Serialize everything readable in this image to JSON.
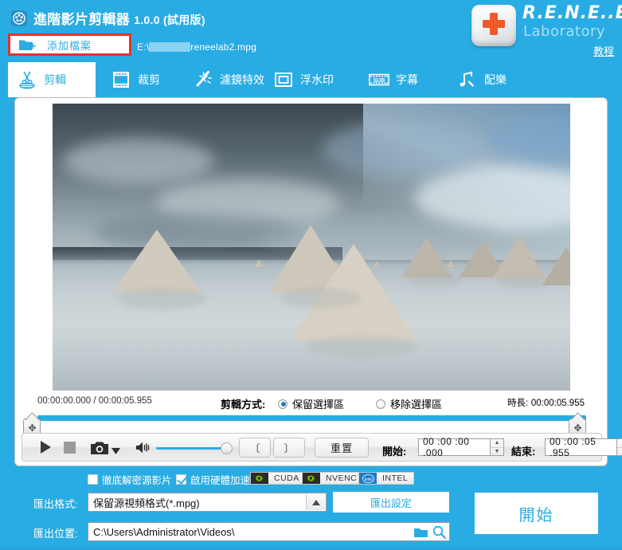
{
  "window": {
    "title": "進階影片剪輯器",
    "version": "1.0.0 (試用版)",
    "app_icon": "film-reel-icon"
  },
  "brand": {
    "name": "R.E.N.E..E",
    "subtitle": "Laboratory",
    "tutorial_link": "教程"
  },
  "toolbar": {
    "add_file_label": "添加檔案",
    "add_file_icon": "add-folder-icon",
    "file_path_prefix": "E:\\",
    "file_path_suffix": "\\reneelab2.mpg",
    "file_name": "reneelab2.mpg"
  },
  "tabs": [
    {
      "id": "edit",
      "label": "剪輯",
      "icon": "scissors-icon",
      "active": true
    },
    {
      "id": "crop",
      "label": "裁剪",
      "icon": "crop-film-icon",
      "active": false
    },
    {
      "id": "filter",
      "label": "濾鏡特效",
      "icon": "magic-wand-icon",
      "active": false
    },
    {
      "id": "watermark",
      "label": "浮水印",
      "icon": "watermark-icon",
      "active": false
    },
    {
      "id": "subtitle",
      "label": "字幕",
      "icon": "sub-film-icon",
      "active": false
    },
    {
      "id": "music",
      "label": "配樂",
      "icon": "music-note-icon",
      "active": false
    }
  ],
  "preview": {
    "description": "salt-flat-cones-video-frame"
  },
  "timeline": {
    "position_label": "00:00:00.000 / 00:00:05.955",
    "current_time": "00:00:00.000",
    "total_time": "00:00:05.955",
    "mode_label": "剪輯方式:",
    "mode_options": [
      {
        "label": "保留選擇區",
        "selected": true
      },
      {
        "label": "移除選擇區",
        "selected": false
      }
    ],
    "duration_label": "時長:",
    "duration_value": "00:00:05.955",
    "left_handle_icon": "move-handle-icon",
    "right_handle_icon": "move-handle-icon"
  },
  "controls": {
    "play_icon": "play-icon",
    "stop_icon": "stop-icon",
    "snapshot_icon": "camera-icon",
    "snapshot_dropdown_icon": "caret-down-icon",
    "volume_icon": "speaker-icon",
    "volume_percent": 100,
    "mark_in_label": "〔",
    "mark_out_label": "〕",
    "reset_label": "重置",
    "start_label": "開始:",
    "start_value": "00 :00 :00 .000",
    "end_label": "結束:",
    "end_value": "00 :00 :05 .955",
    "spinner_up_icon": "spinner-up-icon",
    "spinner_down_icon": "spinner-down-icon"
  },
  "acceleration": {
    "decrypt_label": "徹底解密源影片",
    "decrypt_checked": false,
    "hw_label": "啟用硬體加速",
    "hw_checked": true,
    "chips": [
      {
        "label": "CUDA",
        "logo": "nvidia-icon"
      },
      {
        "label": "NVENC",
        "logo": "nvidia-icon"
      },
      {
        "label": "INTEL",
        "logo": "intel-icon"
      }
    ]
  },
  "export": {
    "format_label": "匯出格式:",
    "format_value": "保留源視頻格式(*.mpg)",
    "format_arrow_icon": "caret-up-icon",
    "settings_label": "匯出設定",
    "location_label": "匯出位置:",
    "location_value": "C:\\Users\\Administrator\\Videos\\",
    "folder_icon": "folder-icon",
    "search_icon": "search-icon",
    "start_label": "開始"
  },
  "colors": {
    "brand_blue": "#29ace3",
    "accent_red": "#e8312c",
    "orange": "#f05a28",
    "white": "#ffffff"
  }
}
